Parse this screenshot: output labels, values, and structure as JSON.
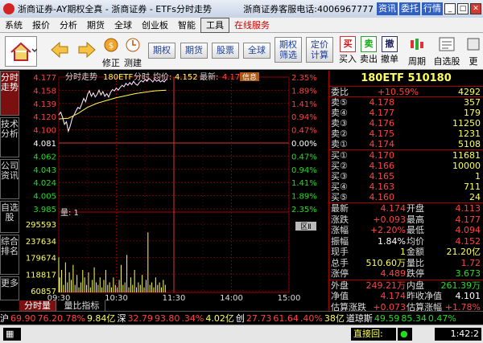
{
  "window": {
    "title": "浙商证券-AY期权全真 - 浙商证券 - ETFs分时走势",
    "hotline_label": "浙商证券客服电话:",
    "hotline": "4006967777",
    "buttons": [
      "资讯",
      "委托",
      "行情"
    ]
  },
  "menu": {
    "items": [
      "系统",
      "报价",
      "分析",
      "期货",
      "全球",
      "创业板",
      "智能",
      "工具"
    ],
    "active": "工具",
    "online": "在线服务"
  },
  "toolbar": {
    "fix": "修正",
    "test": "测建",
    "boxes": [
      "期权",
      "期货",
      "股票",
      "全球"
    ],
    "filter": [
      "期权",
      "筛选"
    ],
    "pricing": [
      "定价",
      "计算"
    ],
    "trade": [
      {
        "glyph": "买",
        "label": "买入"
      },
      {
        "glyph": "卖",
        "label": "卖出"
      },
      {
        "glyph": "撤",
        "label": "撤单"
      }
    ],
    "cycle": "周期",
    "watchlist": "自选股",
    "more": "更"
  },
  "side_tabs": [
    "分时走势",
    "技术分析",
    "公司资讯",
    "自选股",
    "综合排名",
    "更多"
  ],
  "chart_data": {
    "type": "line",
    "header": {
      "tab": "分时走势",
      "name": "180ETF",
      "intraday_label": "分时",
      "avg_label": "均价:",
      "avg": "4.152",
      "last_label": "最新:",
      "last": "4.17",
      "info": "信息"
    },
    "price_ticks": [
      "4.177",
      "4.158",
      "4.139",
      "4.120",
      "4.100",
      "4.081",
      "4.062",
      "4.043",
      "4.024",
      "4.005",
      "3.985"
    ],
    "pct_ticks": [
      "2.35%",
      "1.89%",
      "1.41%",
      "0.94%",
      "0.47%",
      "0.00%",
      "0.47%",
      "0.94%",
      "1.41%",
      "1.89%",
      "2.35%"
    ],
    "ylim": [
      3.985,
      4.177
    ],
    "prev_close": 4.081,
    "volume_label": "量: 1",
    "volume_ticks": [
      "295593",
      "237634",
      "179674",
      "118817",
      "60857"
    ],
    "vol_max": 305000,
    "time_ticks": [
      "09:30",
      "10:30",
      "11:30",
      "14:00",
      "15:00"
    ],
    "total_minutes": 240,
    "zoom": "区Ⅱ",
    "price_series": [
      {
        "t": 0,
        "v": 4.122
      },
      {
        "t": 2,
        "v": 4.126
      },
      {
        "t": 4,
        "v": 4.118
      },
      {
        "t": 6,
        "v": 4.108
      },
      {
        "t": 8,
        "v": 4.112
      },
      {
        "t": 10,
        "v": 4.098
      },
      {
        "t": 12,
        "v": 4.106
      },
      {
        "t": 14,
        "v": 4.117
      },
      {
        "t": 16,
        "v": 4.122
      },
      {
        "t": 18,
        "v": 4.128
      },
      {
        "t": 20,
        "v": 4.133
      },
      {
        "t": 22,
        "v": 4.131
      },
      {
        "t": 24,
        "v": 4.138
      },
      {
        "t": 26,
        "v": 4.146
      },
      {
        "t": 28,
        "v": 4.141
      },
      {
        "t": 30,
        "v": 4.152
      },
      {
        "t": 32,
        "v": 4.157
      },
      {
        "t": 34,
        "v": 4.149
      },
      {
        "t": 36,
        "v": 4.154
      },
      {
        "t": 38,
        "v": 4.148
      },
      {
        "t": 40,
        "v": 4.152
      },
      {
        "t": 42,
        "v": 4.158
      },
      {
        "t": 44,
        "v": 4.151
      },
      {
        "t": 46,
        "v": 4.156
      },
      {
        "t": 48,
        "v": 4.149
      },
      {
        "t": 50,
        "v": 4.153
      },
      {
        "t": 52,
        "v": 4.148
      },
      {
        "t": 54,
        "v": 4.155
      },
      {
        "t": 56,
        "v": 4.159
      },
      {
        "t": 58,
        "v": 4.157
      },
      {
        "t": 60,
        "v": 4.161
      },
      {
        "t": 62,
        "v": 4.158
      },
      {
        "t": 64,
        "v": 4.162
      },
      {
        "t": 66,
        "v": 4.165
      },
      {
        "t": 68,
        "v": 4.163
      },
      {
        "t": 70,
        "v": 4.168
      },
      {
        "t": 72,
        "v": 4.165
      },
      {
        "t": 74,
        "v": 4.169
      },
      {
        "t": 76,
        "v": 4.166
      },
      {
        "t": 78,
        "v": 4.171
      },
      {
        "t": 80,
        "v": 4.167
      },
      {
        "t": 82,
        "v": 4.165
      },
      {
        "t": 84,
        "v": 4.169
      },
      {
        "t": 86,
        "v": 4.172
      },
      {
        "t": 88,
        "v": 4.17
      },
      {
        "t": 90,
        "v": 4.174
      },
      {
        "t": 92,
        "v": 4.171
      },
      {
        "t": 94,
        "v": 4.175
      },
      {
        "t": 96,
        "v": 4.173
      },
      {
        "t": 98,
        "v": 4.17
      },
      {
        "t": 100,
        "v": 4.174
      },
      {
        "t": 102,
        "v": 4.171
      },
      {
        "t": 104,
        "v": 4.173
      },
      {
        "t": 106,
        "v": 4.17
      },
      {
        "t": 108,
        "v": 4.172
      },
      {
        "t": 110,
        "v": 4.17
      },
      {
        "t": 112,
        "v": 4.174
      }
    ],
    "avg_series": [
      {
        "t": 0,
        "v": 4.116
      },
      {
        "t": 10,
        "v": 4.117
      },
      {
        "t": 20,
        "v": 4.124
      },
      {
        "t": 30,
        "v": 4.133
      },
      {
        "t": 40,
        "v": 4.139
      },
      {
        "t": 50,
        "v": 4.143
      },
      {
        "t": 60,
        "v": 4.147
      },
      {
        "t": 70,
        "v": 4.15
      },
      {
        "t": 80,
        "v": 4.153
      },
      {
        "t": 90,
        "v": 4.155
      },
      {
        "t": 100,
        "v": 4.157
      },
      {
        "t": 112,
        "v": 4.158
      }
    ],
    "volume_series": [
      {
        "t": 0,
        "v": 140000
      },
      {
        "t": 1,
        "v": 60000
      },
      {
        "t": 3,
        "v": 90000
      },
      {
        "t": 5,
        "v": 30000
      },
      {
        "t": 7,
        "v": 120000
      },
      {
        "t": 9,
        "v": 40000
      },
      {
        "t": 11,
        "v": 80000
      },
      {
        "t": 13,
        "v": 50000
      },
      {
        "t": 15,
        "v": 110000
      },
      {
        "t": 17,
        "v": 30000
      },
      {
        "t": 19,
        "v": 70000
      },
      {
        "t": 21,
        "v": 20000
      },
      {
        "t": 23,
        "v": 40000
      },
      {
        "t": 25,
        "v": 90000
      },
      {
        "t": 27,
        "v": 60000
      },
      {
        "t": 29,
        "v": 30000
      },
      {
        "t": 31,
        "v": 80000
      },
      {
        "t": 33,
        "v": 20000
      },
      {
        "t": 35,
        "v": 50000
      },
      {
        "t": 37,
        "v": 100000
      },
      {
        "t": 39,
        "v": 40000
      },
      {
        "t": 41,
        "v": 30000
      },
      {
        "t": 43,
        "v": 60000
      },
      {
        "t": 45,
        "v": 20000
      },
      {
        "t": 47,
        "v": 50000
      },
      {
        "t": 49,
        "v": 90000
      },
      {
        "t": 51,
        "v": 30000
      },
      {
        "t": 53,
        "v": 40000
      },
      {
        "t": 55,
        "v": 20000
      },
      {
        "t": 57,
        "v": 60000
      },
      {
        "t": 59,
        "v": 30000
      },
      {
        "t": 61,
        "v": 20000
      },
      {
        "t": 63,
        "v": 50000
      },
      {
        "t": 65,
        "v": 110000
      },
      {
        "t": 67,
        "v": 30000
      },
      {
        "t": 69,
        "v": 40000
      },
      {
        "t": 71,
        "v": 150000
      },
      {
        "t": 73,
        "v": 20000
      },
      {
        "t": 75,
        "v": 60000
      },
      {
        "t": 77,
        "v": 30000
      },
      {
        "t": 79,
        "v": 90000
      },
      {
        "t": 81,
        "v": 20000
      },
      {
        "t": 83,
        "v": 40000
      },
      {
        "t": 85,
        "v": 30000
      },
      {
        "t": 87,
        "v": 70000
      },
      {
        "t": 89,
        "v": 20000
      },
      {
        "t": 91,
        "v": 50000
      },
      {
        "t": 93,
        "v": 240000
      },
      {
        "t": 95,
        "v": 30000
      },
      {
        "t": 97,
        "v": 40000
      },
      {
        "t": 99,
        "v": 20000
      },
      {
        "t": 101,
        "v": 60000
      },
      {
        "t": 103,
        "v": 30000
      },
      {
        "t": 105,
        "v": 40000
      },
      {
        "t": 107,
        "v": 20000
      },
      {
        "t": 109,
        "v": 50000
      },
      {
        "t": 111,
        "v": 30000
      }
    ]
  },
  "bottom_tabs": [
    "分时量",
    "量比指标"
  ],
  "quote": {
    "title": "180ETF 510180",
    "ratio": {
      "label": "委比",
      "pct": "+10.59%",
      "diff": "4292"
    },
    "sells": [
      {
        "label": "卖⑤",
        "price": "4.178",
        "vol": "357"
      },
      {
        "label": "卖④",
        "price": "4.177",
        "vol": "179"
      },
      {
        "label": "卖③",
        "price": "4.176",
        "vol": "11250"
      },
      {
        "label": "卖②",
        "price": "4.175",
        "vol": "1231"
      },
      {
        "label": "卖①",
        "price": "4.174",
        "vol": "5108"
      }
    ],
    "buys": [
      {
        "label": "买①",
        "price": "4.170",
        "vol": "11681"
      },
      {
        "label": "买②",
        "price": "4.166",
        "vol": "10000"
      },
      {
        "label": "买③",
        "price": "4.165",
        "vol": "1"
      },
      {
        "label": "买④",
        "price": "4.163",
        "vol": "711"
      },
      {
        "label": "买⑤",
        "price": "4.160",
        "vol": "24"
      }
    ],
    "stats": [
      {
        "l1": "最新",
        "v1": "4.174",
        "c1": "red",
        "l2": "开盘",
        "v2": "4.113",
        "c2": "red"
      },
      {
        "l1": "涨跌",
        "v1": "+0.093",
        "c1": "red",
        "l2": "最高",
        "v2": "4.177",
        "c2": "red"
      },
      {
        "l1": "涨幅",
        "v1": "+2.20%",
        "c1": "red",
        "l2": "最低",
        "v2": "4.094",
        "c2": "red"
      },
      {
        "l1": "振幅",
        "v1": "1.84%",
        "c1": "white",
        "l2": "均价",
        "v2": "4.152",
        "c2": "red"
      },
      {
        "l1": "现手",
        "v1": "1",
        "c1": "yellow",
        "l2": "金额",
        "v2": "21.20亿",
        "c2": "yellow"
      },
      {
        "l1": "总手",
        "v1": "510.60万",
        "c1": "yellow",
        "l2": "量比",
        "v2": "1.72",
        "c2": "red"
      },
      {
        "l1": "涨停",
        "v1": "4.489",
        "c1": "red",
        "l2": "跌停",
        "v2": "3.673",
        "c2": "green"
      }
    ],
    "stats2": [
      {
        "l1": "外盘",
        "v1": "249.21万",
        "c1": "red",
        "l2": "内盘",
        "v2": "261.39万",
        "c2": "green"
      },
      {
        "l1": "净值",
        "v1": "4.174",
        "c1": "red",
        "l2": "昨收净值",
        "v2": "4.101",
        "c2": "white"
      },
      {
        "l1": "估算涨跌",
        "v1": "+0.073",
        "c1": "red",
        "l2": "估算涨幅",
        "v2": "+1.78%",
        "c2": "red"
      }
    ]
  },
  "ticker": {
    "segments": [
      {
        "text": "沪",
        "c": "white"
      },
      {
        "text": "69.90",
        "c": "red"
      },
      {
        "text": "76.20.78%",
        "c": "red"
      },
      {
        "text": "9.84亿",
        "c": "yellow"
      },
      {
        "text": "深",
        "c": "white"
      },
      {
        "text": "32.79",
        "c": "red"
      },
      {
        "text": "93.80",
        "c": "red"
      },
      {
        "text": ".34%",
        "c": "red"
      },
      {
        "text": "4.02亿",
        "c": "yellow"
      },
      {
        "text": "创",
        "c": "white"
      },
      {
        "text": "27.73",
        "c": "red"
      },
      {
        "text": "61.64",
        "c": "red"
      },
      {
        "text": ".40%",
        "c": "red"
      },
      {
        "text": "38亿",
        "c": "yellow"
      },
      {
        "text": "道琼斯",
        "c": "white"
      },
      {
        "text": "49.59",
        "c": "green"
      },
      {
        "text": "85.34",
        "c": "green"
      },
      {
        "text": "0.47%",
        "c": "green"
      }
    ]
  },
  "status": {
    "live": "直接回:",
    "time": "1:42:2"
  }
}
